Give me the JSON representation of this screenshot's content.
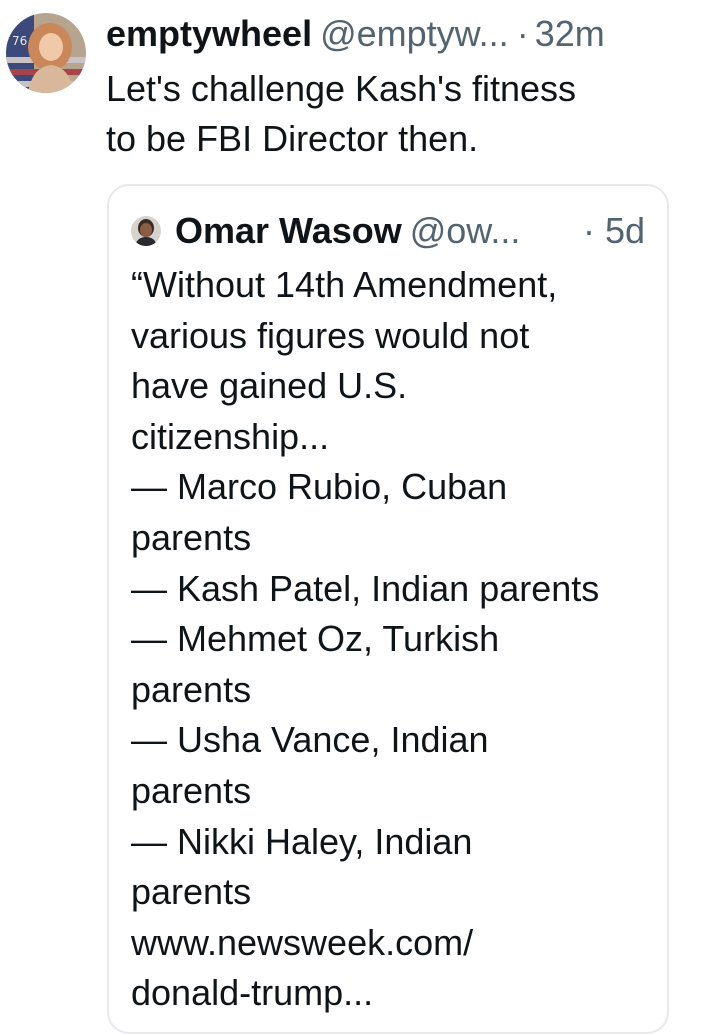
{
  "tweet": {
    "author": {
      "display_name": "emptywheel",
      "handle": "@emptyw...",
      "separator": "·",
      "timestamp": "32m",
      "avatar": "profile-photo-avatar",
      "avatar_badge": "76"
    },
    "text_lines": [
      "Let's challenge Kash's fitness",
      "to be FBI Director then."
    ]
  },
  "quoted_tweet": {
    "author": {
      "display_name": "Omar Wasow",
      "handle": "@ow...",
      "timestamp": "· 5d",
      "avatar": "profile-photo-avatar"
    },
    "text_lines": [
      "“Without 14th Amendment,",
      "various figures would not",
      "have gained U.S.",
      "citizenship...",
      "— Marco Rubio, Cuban",
      "parents",
      "— Kash Patel, Indian parents",
      "— Mehmet Oz, Turkish",
      "parents",
      "— Usha Vance, Indian",
      "parents",
      "— Nikki Haley, Indian",
      "parents",
      "www.newsweek.com/",
      "donald-trump..."
    ]
  },
  "colors": {
    "text_primary": "#0f1419",
    "text_secondary": "#536471",
    "card_border": "#e7e9ec"
  }
}
